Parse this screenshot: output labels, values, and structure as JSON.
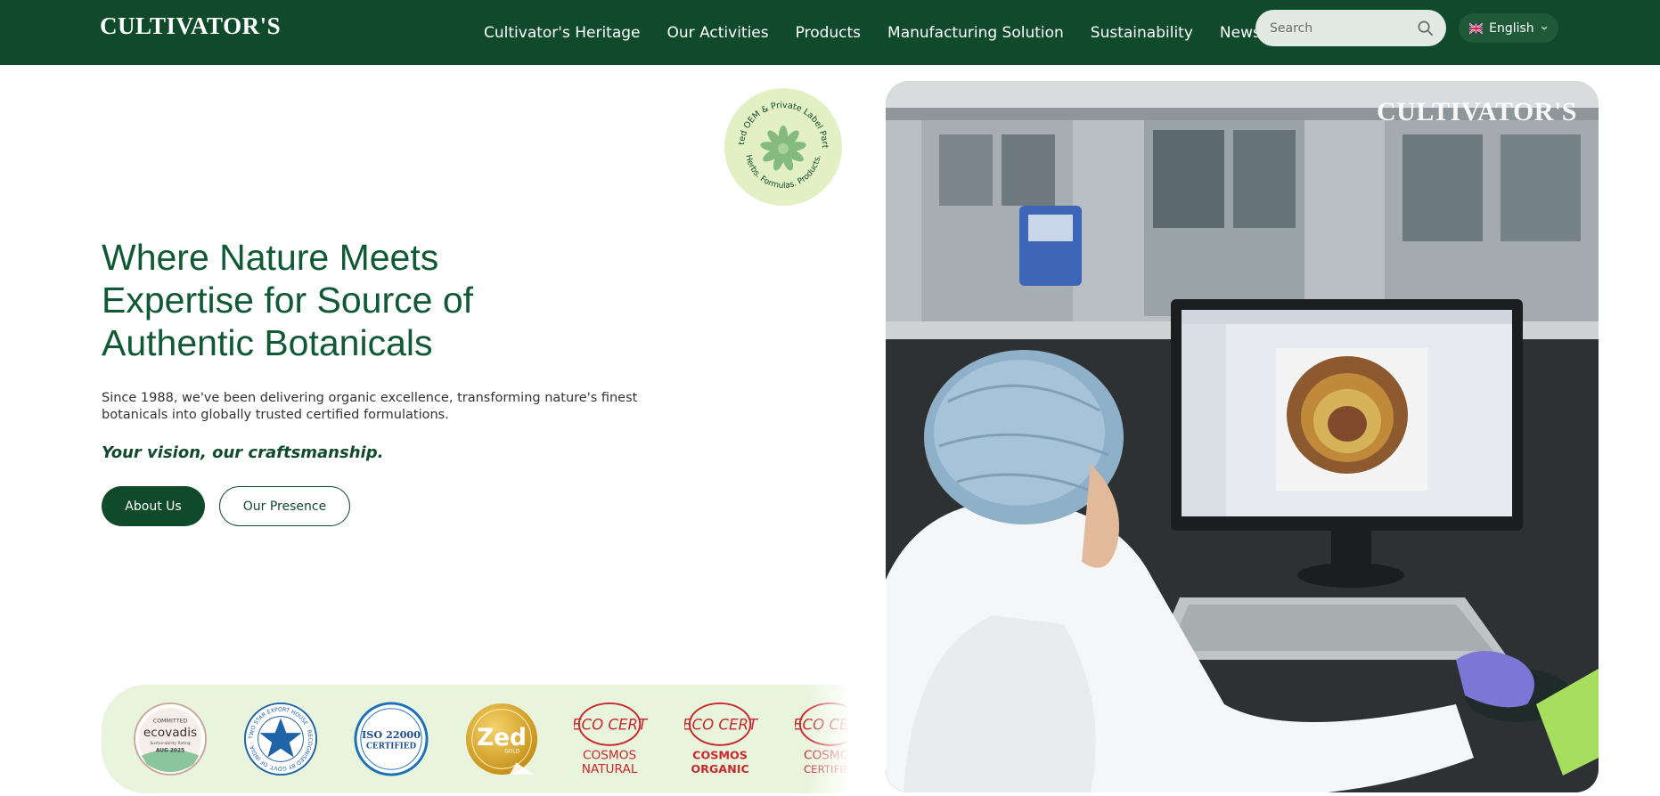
{
  "brand": {
    "logo_text": "CULTIVATOR'S"
  },
  "nav": {
    "items": [
      {
        "label": "Cultivator's Heritage"
      },
      {
        "label": "Our Activities"
      },
      {
        "label": "Products"
      },
      {
        "label": "Manufacturing Solution"
      },
      {
        "label": "Sustainability"
      },
      {
        "label": "News & Events"
      }
    ],
    "search": {
      "placeholder": "Search",
      "icon": "search-icon"
    },
    "language": {
      "label": "English",
      "flag": "uk-flag-icon",
      "icon": "chevron-down-icon"
    }
  },
  "badge": {
    "text": "Trusted OEM & Private Label Partner",
    "text_bottom": "Herbs. Formulas. Products."
  },
  "hero": {
    "headline": "Where Nature Meets Expertise for Source of Authentic Botanicals",
    "subtext": "Since 1988, we've been delivering organic excellence, transforming nature's finest botanicals into globally trusted certified formulations.",
    "tagline": "Your vision, our craftsmanship.",
    "primary_button": "About Us",
    "secondary_button": "Our Presence",
    "image_watermark": "CULTIVATOR'S"
  },
  "certifications": [
    {
      "name": "ecovadis",
      "top": "COMMITTED",
      "main": "ecovadis",
      "small": "Sustainability Rating",
      "date": "AUG 2025"
    },
    {
      "name": "two-star-export-house",
      "text": "TWO STAR EXPORT HOUSE · RECOGNISED BY GOVT. OF INDIA ·"
    },
    {
      "name": "iso-22000",
      "line1": "ISO 22000",
      "line2": "CERTIFIED"
    },
    {
      "name": "zed-gold",
      "main": "Zed",
      "small": "GOLD"
    },
    {
      "name": "ecocert-cosmos-natural",
      "logo": "ECO CERT",
      "line1": "COSMOS",
      "line2": "NATURAL"
    },
    {
      "name": "ecocert-cosmos-organic",
      "logo": "ECO CERT",
      "line1": "COSMOS",
      "line2": "ORGANIC"
    },
    {
      "name": "ecocert-cosmos-certified",
      "logo": "ECO CERT",
      "line1": "COSMOS",
      "line2": "CERTIFIED"
    }
  ],
  "colors": {
    "primary": "#0f4a2a",
    "headline": "#0f5a34",
    "strip_bg": "#e9f4dc",
    "badge_bg": "#e2f0c4",
    "ecocert_red": "#c8282e"
  }
}
